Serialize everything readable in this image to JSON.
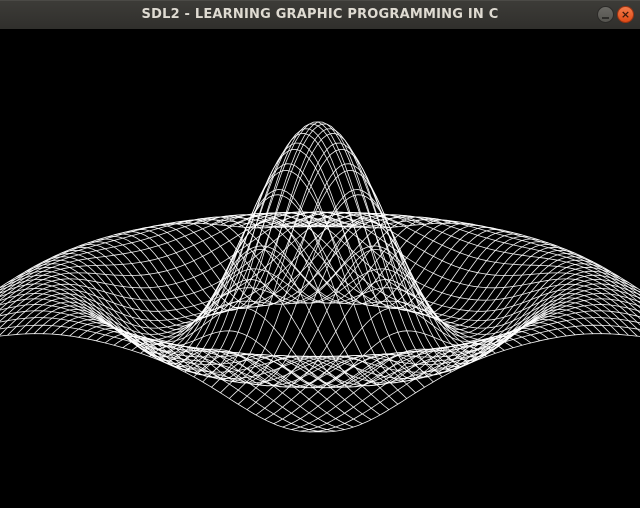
{
  "window": {
    "title": "SDL2 - LEARNING GRAPHIC PROGRAMMING IN C"
  },
  "titlebar": {
    "minimize_icon": "minimize-icon",
    "close_icon": "close-icon",
    "close_glyph": "×"
  },
  "colors": {
    "titlebar": "#353431",
    "title_text": "#dfdbd2",
    "close_button": "#e95420",
    "canvas_background": "#000000",
    "wireframe": "#ffffff"
  },
  "scene": {
    "type": "wireframe-surface",
    "function": "sinc-like radial ripple",
    "grid_lines": 46
  }
}
